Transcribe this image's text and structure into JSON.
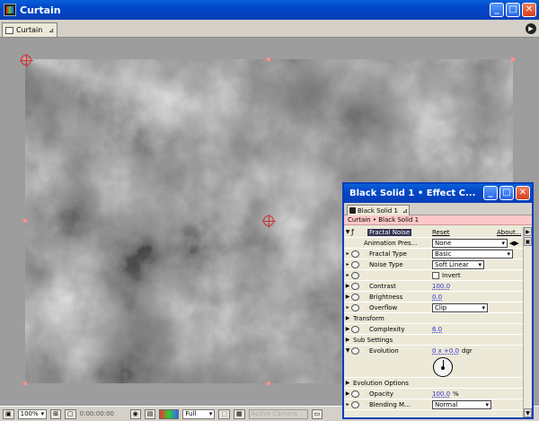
{
  "window": {
    "title": "Curtain"
  },
  "comp_tab": {
    "label": "Curtain"
  },
  "statusbar": {
    "zoom": "100%",
    "timecode": "0:00:00:00",
    "resolution": "Full",
    "camera": "Active Camera"
  },
  "effect_panel": {
    "title": "Black Solid 1 • Effect C...",
    "tab": "Black Solid 1",
    "breadcrumb": "Curtain • Black Solid 1",
    "effect_name": "Fractal Noise",
    "reset": "Reset",
    "about": "About...",
    "rows": [
      {
        "label": "Animation Pres...",
        "value": "None",
        "kind": "dropdown"
      },
      {
        "label": "Fractal Type",
        "value": "Basic",
        "kind": "dropdown"
      },
      {
        "label": "Noise Type",
        "value": "Soft Linear",
        "kind": "dropdown"
      },
      {
        "label": "Invert",
        "kind": "checkbox"
      },
      {
        "label": "Contrast",
        "value": "100.0",
        "kind": "number"
      },
      {
        "label": "Brightness",
        "value": "0.0",
        "kind": "number"
      },
      {
        "label": "Overflow",
        "value": "Clip",
        "kind": "dropdown"
      },
      {
        "label": "Transform",
        "kind": "group"
      },
      {
        "label": "Complexity",
        "value": "6.0",
        "kind": "number"
      },
      {
        "label": "Sub Settings",
        "kind": "group"
      },
      {
        "label": "Evolution",
        "value": "0 x +0.0",
        "unit": "dgr",
        "kind": "angle"
      },
      {
        "label": "Evolution Options",
        "kind": "group"
      },
      {
        "label": "Opacity",
        "value": "100.0",
        "unit": "%",
        "kind": "number"
      },
      {
        "label": "Blending M...",
        "value": "Normal",
        "kind": "dropdown"
      }
    ]
  }
}
